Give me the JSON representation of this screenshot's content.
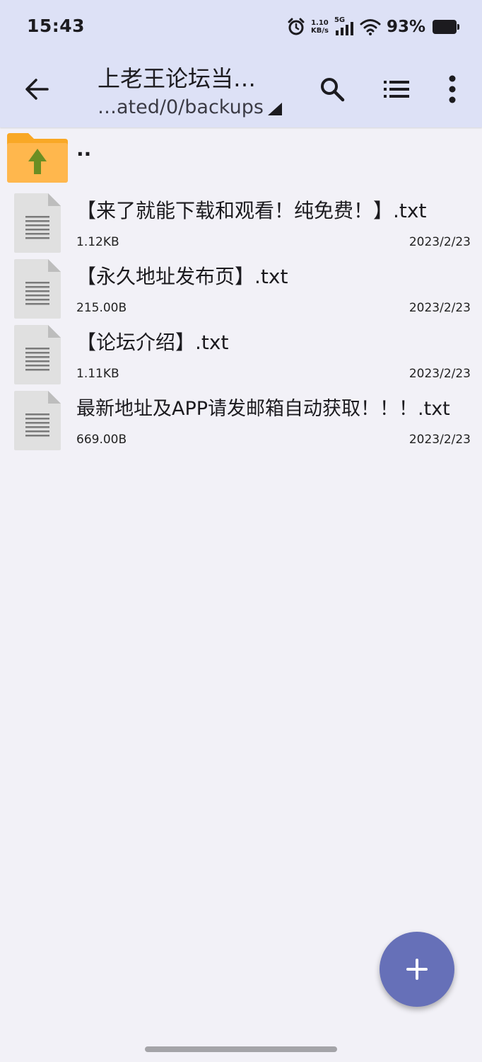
{
  "status_bar": {
    "time": "15:43",
    "net_speed_value": "1.10",
    "net_speed_unit": "KB/s",
    "network_type": "5G",
    "battery": "93%"
  },
  "toolbar": {
    "title": "上老王论坛当…",
    "path": "…ated/0/backups"
  },
  "icons": {
    "back": "arrow-back-icon",
    "search": "search-icon",
    "view": "list-view-icon",
    "more": "more-vert-icon",
    "fab": "plus-icon"
  },
  "parent_dir": {
    "label": ".."
  },
  "files": [
    {
      "name": "【来了就能下载和观看！纯免费！】.txt",
      "size": "1.12KB",
      "date": "2023/2/23"
    },
    {
      "name": "【永久地址发布页】.txt",
      "size": "215.00B",
      "date": "2023/2/23"
    },
    {
      "name": "【论坛介绍】.txt",
      "size": "1.11KB",
      "date": "2023/2/23"
    },
    {
      "name": "最新地址及APP请发邮箱自动获取！！！.txt",
      "size": "669.00B",
      "date": "2023/2/23"
    }
  ],
  "colors": {
    "appbar": "#dde1f6",
    "background": "#f2f1f7",
    "fab": "#6670b8",
    "folder": "#f9a825",
    "up_arrow": "#6b8e23"
  }
}
